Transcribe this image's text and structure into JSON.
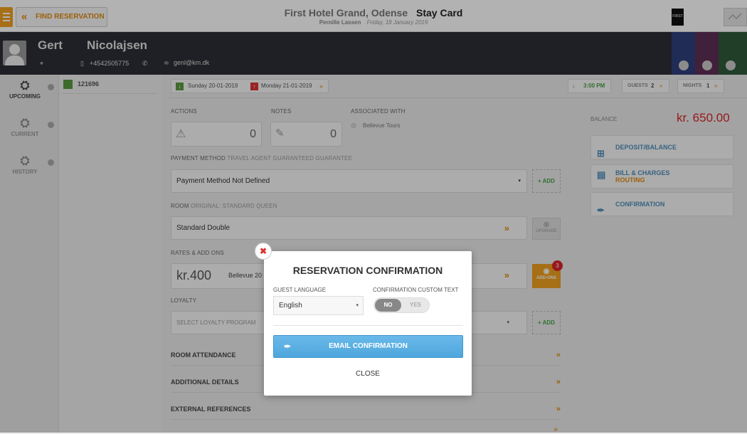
{
  "topbar": {
    "find_reservation": "FIND RESERVATION",
    "hotel_name": "First Hotel Grand, Odense",
    "page_title": "Stay Card",
    "user": "Pernille Lassen",
    "date": "Friday, 18 January 2019",
    "logo_text": "FIRST"
  },
  "guest": {
    "first_name": "Gert",
    "last_name": "Nicolajsen",
    "phone": "+4542505775",
    "email": "genl@km.dk"
  },
  "sidebar": {
    "items": [
      {
        "label": "UPCOMING"
      },
      {
        "label": "CURRENT"
      },
      {
        "label": "HISTORY"
      }
    ]
  },
  "reservation": {
    "number": "121696"
  },
  "dates": {
    "arrival": "Sunday 20-01-2019",
    "departure": "Monday 21-01-2019",
    "time": "3:00 PM",
    "guests_label": "GUESTS",
    "guests_value": "2",
    "nights_label": "NIGHTS",
    "nights_value": "1"
  },
  "actions": {
    "label": "ACTIONS",
    "count": "0"
  },
  "notes": {
    "label": "NOTES",
    "count": "0"
  },
  "associated": {
    "label": "ASSOCIATED WITH",
    "value": "Bellevue Tours"
  },
  "payment": {
    "label": "PAYMENT METHOD",
    "sub": "TRAVEL AGENT GUARANTEED GUARANTEE",
    "value": "Payment Method Not Defined",
    "add": "+ ADD"
  },
  "room": {
    "label": "ROOM",
    "sub": "ORIGINAL: STANDARD QUEEN",
    "value": "Standard Double",
    "upgrade": "UPGRADE"
  },
  "rates": {
    "label": "RATES & ADD ONS",
    "amount": "kr.400",
    "name": "Bellevue 20",
    "addons": "ADD-ONS",
    "addons_count": "3"
  },
  "loyalty": {
    "label": "LOYALTY",
    "placeholder": "SELECT LOYALTY PROGRAM",
    "add": "+ ADD"
  },
  "sections": {
    "room_attendance": "ROOM ATTENDANCE",
    "additional_details": "ADDITIONAL DETAILS",
    "external_references": "EXTERNAL REFERENCES"
  },
  "balance": {
    "label": "BALANCE",
    "amount": "kr. 650.00"
  },
  "right_buttons": {
    "deposit": "DEPOSIT/BALANCE",
    "bill_line1": "BILL & CHARGES",
    "bill_line2": "ROUTING",
    "confirmation": "CONFIRMATION"
  },
  "modal": {
    "title": "RESERVATION CONFIRMATION",
    "guest_language_label": "GUEST LANGUAGE",
    "guest_language_value": "English",
    "custom_text_label": "CONFIRMATION CUSTOM TEXT",
    "toggle_no": "NO",
    "toggle_yes": "YES",
    "email_button": "EMAIL CONFIRMATION",
    "close": "CLOSE"
  },
  "colors": {
    "accent": "#e08a10",
    "balance_red": "#d9252a",
    "email_blue": "#4ea6dc",
    "header_dark": "#2d2f36"
  }
}
